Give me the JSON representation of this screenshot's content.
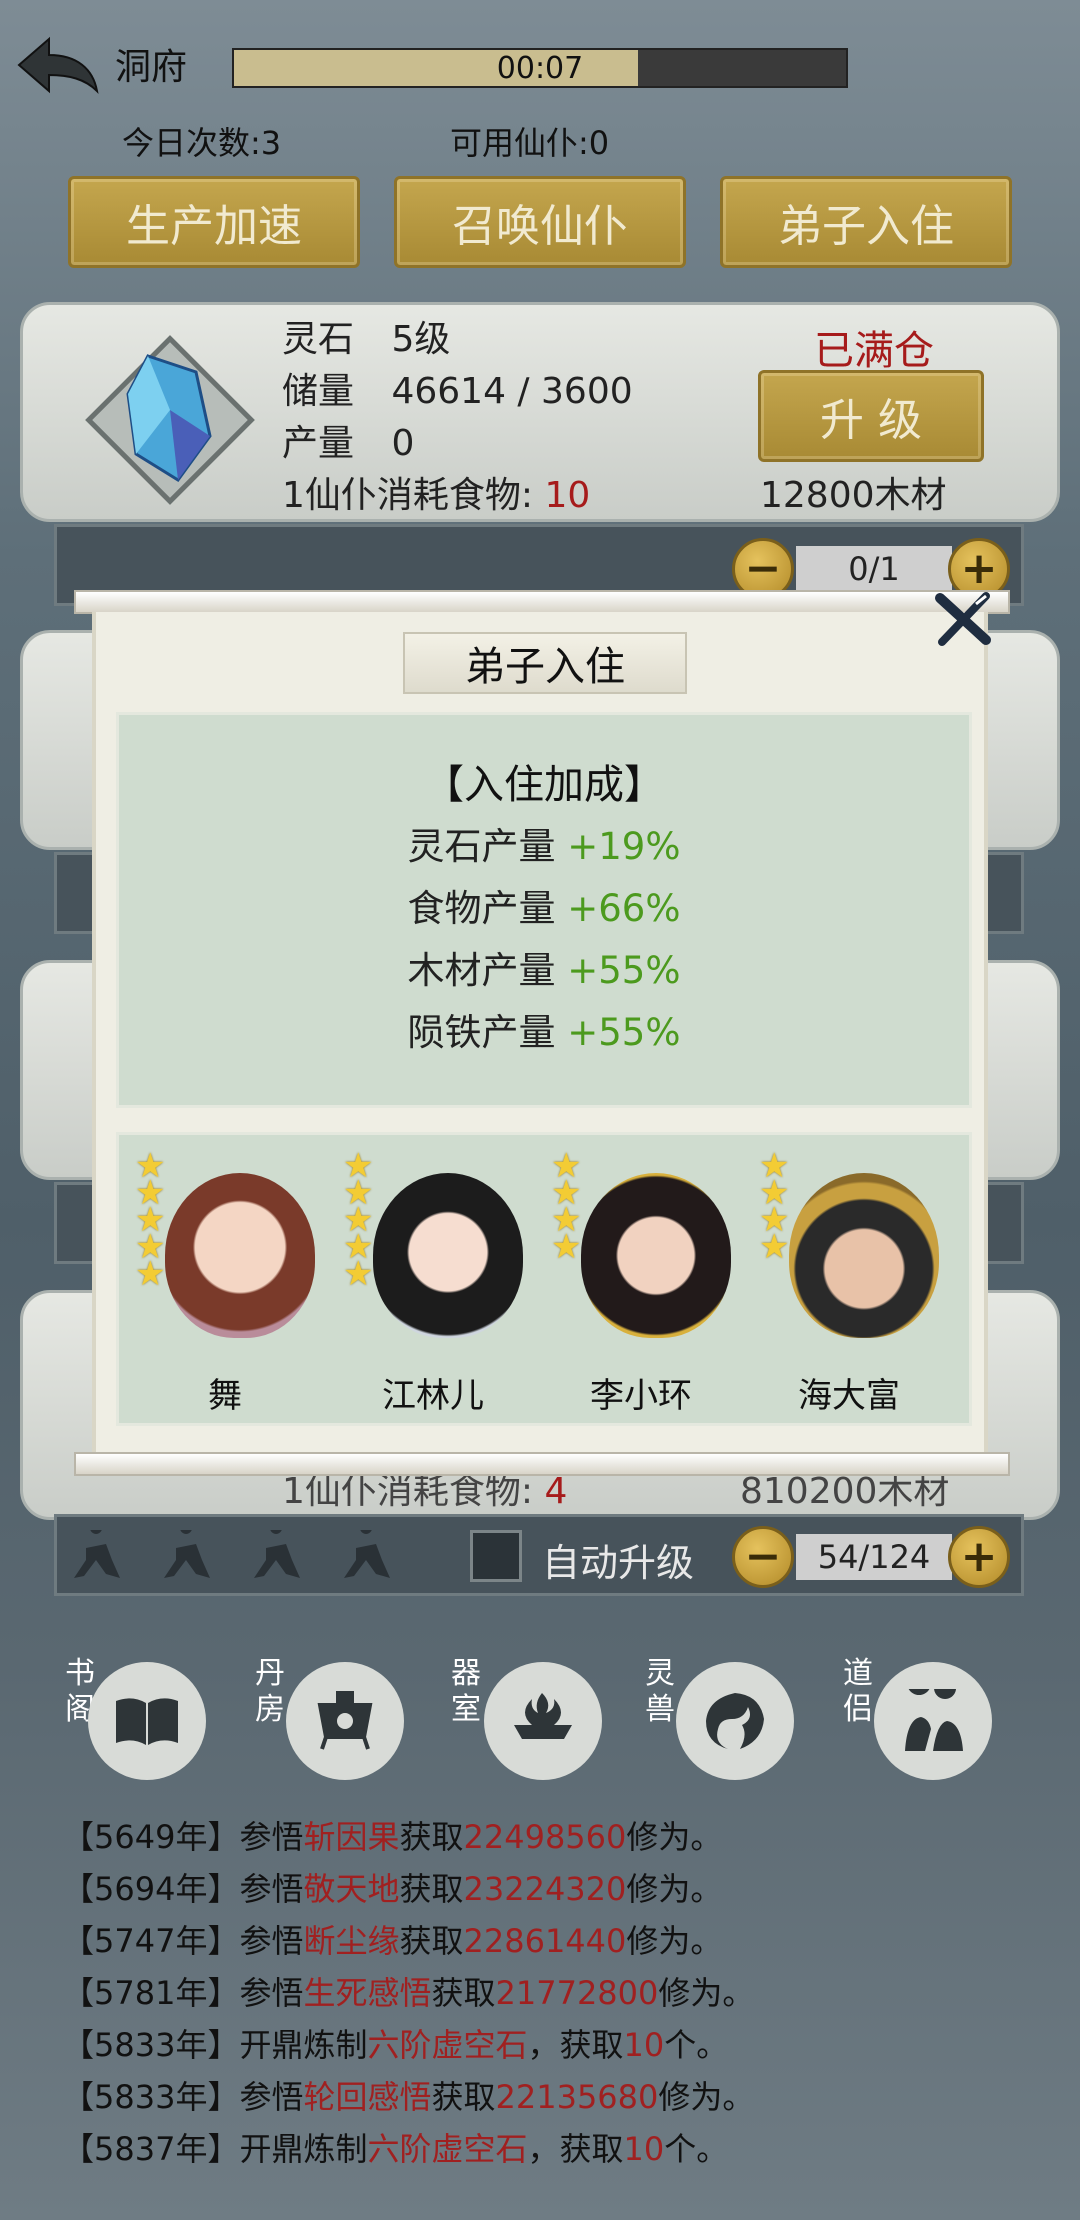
{
  "header": {
    "title": "洞府",
    "timer": "00:07",
    "timer_progress": 0.66,
    "today_count": "今日次数:3",
    "available_servants": "可用仙仆:0"
  },
  "actions": {
    "speedup": "生产加速",
    "summon": "召唤仙仆",
    "disciple": "弟子入住"
  },
  "building": {
    "name": "灵石",
    "level": "5级",
    "storage_label": "储量",
    "storage_value": "46614 / 3600",
    "output_label": "产量",
    "output_value": "0",
    "consume_label": "1仙仆消耗食物:",
    "consume_value": "10",
    "status": "已满仓",
    "upgrade": "升 级",
    "cost": "12800木材",
    "servant_count": "0/1"
  },
  "lower_panel": {
    "consume_partial": "1仙仆消耗食物:",
    "consume_value": "4",
    "cost_partial": "810200木材",
    "auto_upgrade": "自动升级",
    "servant_count": "54/124"
  },
  "counter": {
    "minus": "−",
    "plus": "+"
  },
  "modal": {
    "title": "弟子入住",
    "close": "✕",
    "bonus_heading": "【入住加成】",
    "bonuses": [
      {
        "label": "灵石产量",
        "value": "+19%"
      },
      {
        "label": "食物产量",
        "value": "+66%"
      },
      {
        "label": "木材产量",
        "value": "+55%"
      },
      {
        "label": "陨铁产量",
        "value": "+55%"
      }
    ],
    "characters": [
      {
        "name": "舞",
        "stars": 5
      },
      {
        "name": "江林儿",
        "stars": 5
      },
      {
        "name": "李小环",
        "stars": 4
      },
      {
        "name": "海大富",
        "stars": 4
      }
    ]
  },
  "nav": [
    {
      "tag": "书阁",
      "icon": "book-icon"
    },
    {
      "tag": "丹房",
      "icon": "cauldron-icon"
    },
    {
      "tag": "器室",
      "icon": "forge-icon"
    },
    {
      "tag": "灵兽",
      "icon": "phoenix-icon"
    },
    {
      "tag": "道侣",
      "icon": "couple-icon"
    }
  ],
  "logs": [
    {
      "year": "【5649年】",
      "verb": "参悟",
      "item": "斩因果",
      "mid": "获取",
      "amount": "22498560",
      "tail": "修为。"
    },
    {
      "year": "【5694年】",
      "verb": "参悟",
      "item": "敬天地",
      "mid": "获取",
      "amount": "23224320",
      "tail": "修为。"
    },
    {
      "year": "【5747年】",
      "verb": "参悟",
      "item": "断尘缘",
      "mid": "获取",
      "amount": "22861440",
      "tail": "修为。"
    },
    {
      "year": "【5781年】",
      "verb": "参悟",
      "item": "生死感悟",
      "mid": "获取",
      "amount": "21772800",
      "tail": "修为。"
    },
    {
      "year": "【5833年】",
      "verb": "开鼎炼制",
      "item": "六阶虚空石",
      "mid": "，获取",
      "amount": "10",
      "tail": "个。"
    },
    {
      "year": "【5833年】",
      "verb": "参悟",
      "item": "轮回感悟",
      "mid": "获取",
      "amount": "22135680",
      "tail": "修为。"
    },
    {
      "year": "【5837年】",
      "verb": "开鼎炼制",
      "item": "六阶虚空石",
      "mid": "，获取",
      "amount": "10",
      "tail": "个。"
    }
  ]
}
